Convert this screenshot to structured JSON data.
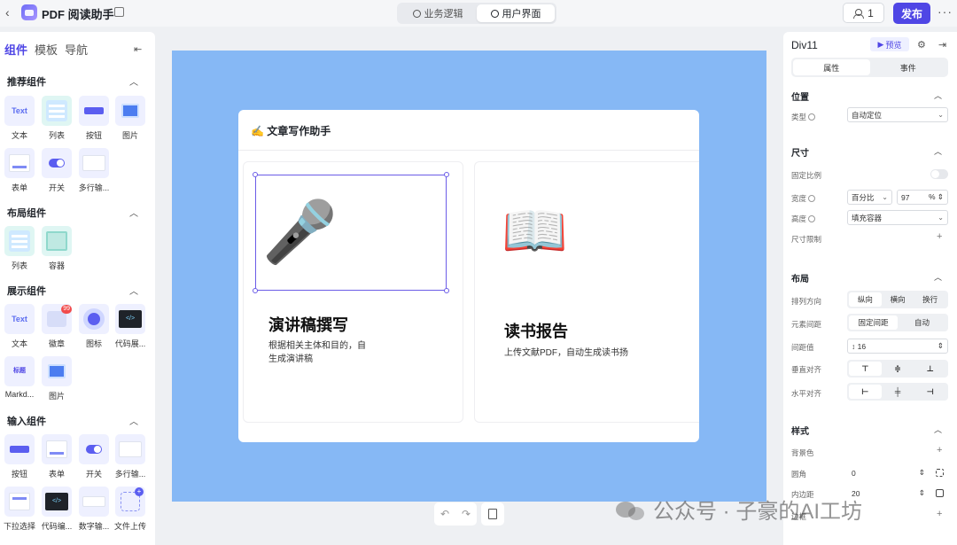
{
  "app": {
    "title": "PDF 阅读助手"
  },
  "topbar": {
    "tabs": [
      {
        "label": "业务逻辑"
      },
      {
        "label": "用户界面"
      }
    ],
    "users_count": "1",
    "publish": "发布"
  },
  "left": {
    "tabs": [
      "组件",
      "模板",
      "导航"
    ],
    "sections": {
      "recommended": "推荐组件",
      "layout": "布局组件",
      "display": "展示组件",
      "input": "输入组件"
    },
    "recommended_items": [
      "文本",
      "列表",
      "按钮",
      "图片",
      "表单",
      "开关",
      "多行输..."
    ],
    "layout_items": [
      "列表",
      "容器"
    ],
    "display_items": [
      "文本",
      "徽章",
      "图标",
      "代码展...",
      "Markd...",
      "图片"
    ],
    "input_items": [
      "按钮",
      "表单",
      "开关",
      "多行输...",
      "下拉选择",
      "代码编...",
      "数字输...",
      "文件上传"
    ],
    "tile_texts": {
      "text": "Text",
      "badge_count": "99",
      "markdown": "标题"
    }
  },
  "canvas": {
    "card_title": "✍️ 文章写作助手",
    "features": [
      {
        "emoji": "🎤",
        "title": "演讲稿撰写",
        "desc": "根据相关主体和目的，自\n生成演讲稿"
      },
      {
        "emoji": "📖",
        "title": "读书报告",
        "desc": "上传文献PDF，自动生成读书扬"
      }
    ]
  },
  "right": {
    "title": "Div11",
    "preview": "预览",
    "tabs": [
      "属性",
      "事件"
    ],
    "sections": {
      "position": "位置",
      "size": "尺寸",
      "layout": "布局",
      "style": "样式"
    },
    "position": {
      "type_label": "类型",
      "type_value": "自动定位"
    },
    "size": {
      "ratio_label": "固定比例",
      "width_label": "宽度",
      "width_unit": "百分比",
      "width_value": "97",
      "width_suffix": "%",
      "height_label": "高度",
      "height_value": "填充容器",
      "limit_label": "尺寸限制"
    },
    "layout": {
      "direction_label": "排列方向",
      "direction_options": [
        "纵向",
        "横向",
        "换行"
      ],
      "gap_label": "元素间距",
      "gap_options": [
        "固定间距",
        "自动"
      ],
      "gap_value_label": "间距值",
      "gap_value": "16",
      "valign_label": "垂直对齐",
      "halign_label": "水平对齐"
    },
    "style": {
      "bg_label": "背景色",
      "radius_label": "圆角",
      "radius_value": "0",
      "padding_label": "内边距",
      "padding_value": "20",
      "border_label": "边框"
    }
  },
  "watermark": "公众号 · 子豪的AI工坊"
}
